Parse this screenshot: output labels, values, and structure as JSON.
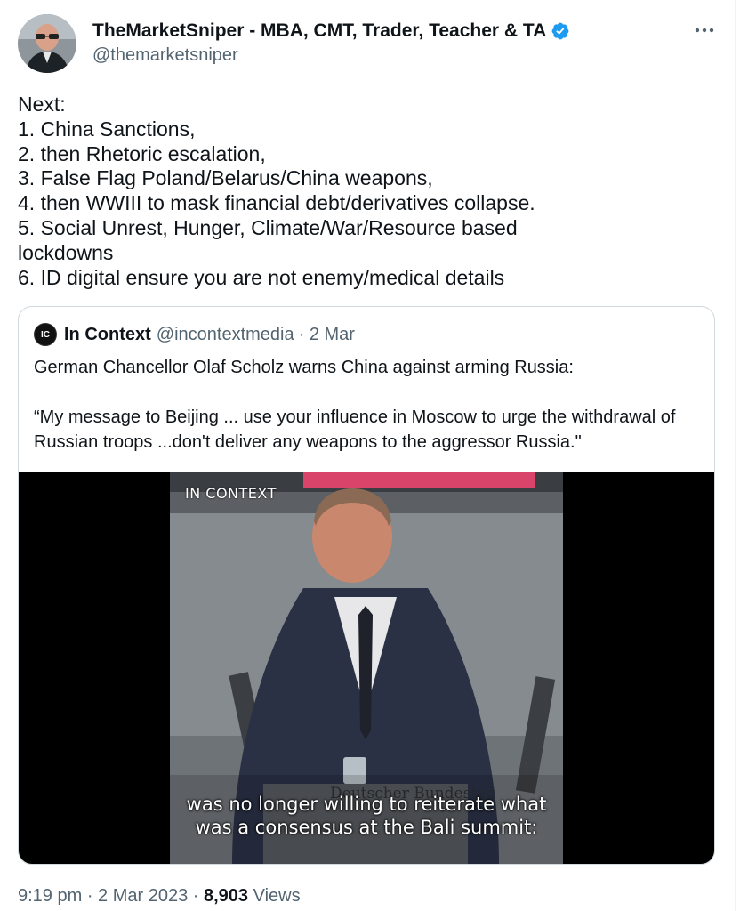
{
  "author": {
    "display_name": "TheMarketSniper - MBA, CMT, Trader, Teacher & TA",
    "handle": "@themarketsniper",
    "verified": true
  },
  "tweet_lines": [
    "Next:",
    "1. China Sanctions,",
    "2. then Rhetoric escalation,",
    "3. False Flag Poland/Belarus/China weapons,",
    "4. then WWIII to mask financial debt/derivatives collapse.",
    "5. Social Unrest, Hunger, Climate/War/Resource based",
    "lockdowns",
    "6. ID digital ensure you are not enemy/medical details"
  ],
  "quote": {
    "avatar_text": "IC",
    "name": "In Context",
    "handle": "@incontextmedia",
    "date": "· 2 Mar",
    "text_1": "German Chancellor Olaf Scholz warns China against arming Russia:",
    "text_2": "“My message to Beijing ... use your influence in Moscow to urge the withdrawal of Russian troops ...don't deliver any weapons to the aggressor Russia.\"",
    "video": {
      "watermark": "IN CONTEXT",
      "lectern_text": "Deutscher Bundestag",
      "subtitle_1": "was no longer willing to reiterate what",
      "subtitle_2": "was a consensus at the Bali summit:"
    }
  },
  "meta": {
    "time": "9:19 pm",
    "sep1": " · ",
    "date": "2 Mar 2023",
    "sep2": " · ",
    "views_count": "8,903",
    "views_label": " Views"
  },
  "colors": {
    "text": "#0f1419",
    "secondary": "#536471",
    "verified": "#1d9bf0",
    "border": "#cfd9de"
  },
  "icons": [
    "verified-badge-icon",
    "more-options-icon"
  ]
}
